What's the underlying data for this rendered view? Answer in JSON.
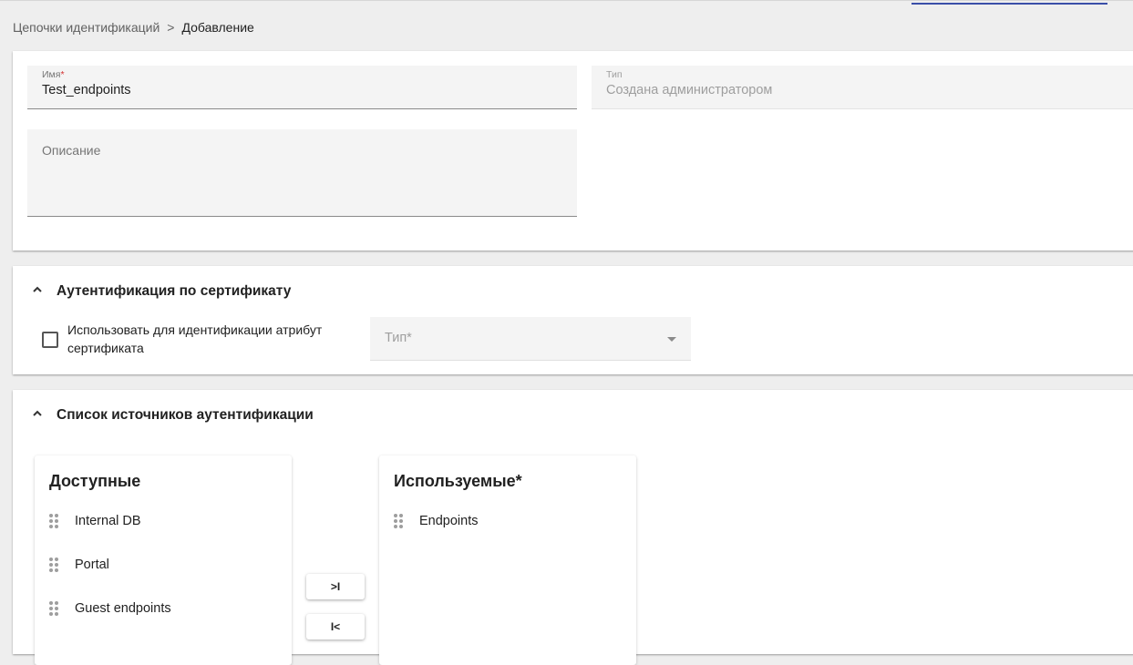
{
  "breadcrumb": {
    "parent": "Цепочки идентификаций",
    "separator": ">",
    "current": "Добавление"
  },
  "main_card": {
    "name_field": {
      "label": "Имя",
      "required_mark": "*",
      "value": "Test_endpoints"
    },
    "type_field": {
      "label": "Тип",
      "value": "Создана администратором"
    },
    "description_field": {
      "label": "Описание",
      "value": ""
    }
  },
  "cert_section": {
    "title": "Аутентификация по сертификату",
    "checkbox_label": "Использовать для идентификации атрибут сертификата",
    "checkbox_checked": false,
    "type_select_placeholder": "Тип*"
  },
  "sources_section": {
    "title": "Список источников аутентификации",
    "available": {
      "title": "Доступные",
      "items": [
        "Internal DB",
        "Portal",
        "Guest endpoints"
      ]
    },
    "used": {
      "title": "Используемые*",
      "items": [
        "Endpoints"
      ]
    },
    "move_right_label": ">I",
    "move_left_label": "I<"
  },
  "colors": {
    "accent": "#3a4fa8",
    "required": "#d32f2f"
  }
}
